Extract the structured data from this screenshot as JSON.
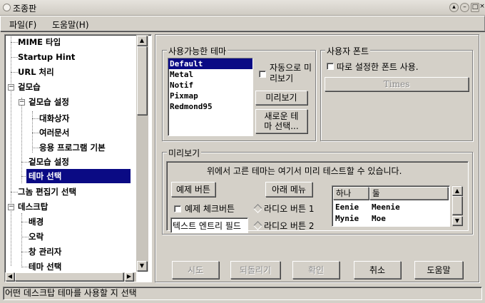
{
  "window": {
    "title": "조종판"
  },
  "menu": {
    "file": "파일(F)",
    "help": "도움말(H)"
  },
  "tree": {
    "items": [
      {
        "label": "MIME 타입"
      },
      {
        "label": "Startup Hint"
      },
      {
        "label": "URL 처리"
      },
      {
        "label": "겉모습"
      },
      {
        "label": "겉모습 설정"
      },
      {
        "label": "대화상자"
      },
      {
        "label": "여러문서"
      },
      {
        "label": "응용 프로그램 기본"
      },
      {
        "label": "겉모습 설정"
      },
      {
        "label": "테마 선택"
      },
      {
        "label": "그놈 편집기 선택"
      },
      {
        "label": "데스크탑"
      },
      {
        "label": "배경"
      },
      {
        "label": "오락"
      },
      {
        "label": "창 관리자"
      },
      {
        "label": "테마 선택"
      }
    ]
  },
  "themes": {
    "group_title": "사용가능한 테마",
    "list": [
      "Default",
      "Metal",
      "Notif",
      "Pixmap",
      "Redmond95"
    ],
    "selected": "Default",
    "auto_preview_label": "자동으로 미리보기",
    "preview_button": "미리보기",
    "new_theme_button": "새로운 테마 선택..."
  },
  "font": {
    "group_title": "사용자 폰트",
    "use_custom_label": "따로 설정한 폰트 사용.",
    "font_button": "Times"
  },
  "preview": {
    "group_title": "미리보기",
    "description": "위에서 고른 테마는 여기서 미리 테스트할 수 있습니다.",
    "example_button": "예제 버튼",
    "menu_button": "아래 메뉴",
    "example_check": "예제 체크버튼",
    "radio1": "라디오 버튼 1",
    "radio2": "라디오 버튼 2",
    "entry_value": "텍스트 엔트리 필드",
    "clist": {
      "headers": [
        "하나",
        "둘"
      ],
      "rows": [
        [
          "Eenie",
          "Meenie"
        ],
        [
          "Mynie",
          "Moe"
        ]
      ]
    }
  },
  "buttons": {
    "try": "시도",
    "revert": "되돌리기",
    "ok": "확인",
    "cancel": "취소",
    "help": "도움말"
  },
  "status": "어떤 데스크탑 테마를 사용할 지 선택"
}
